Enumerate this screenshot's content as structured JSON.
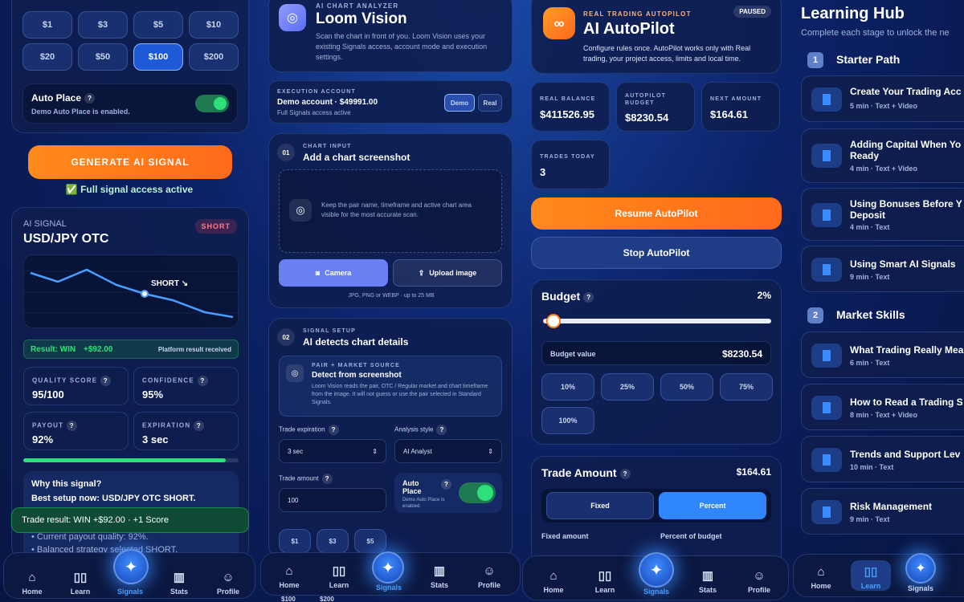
{
  "signals": {
    "amounts": [
      "$1",
      "$3",
      "$5",
      "$10",
      "$20",
      "$50",
      "$100",
      "$200"
    ],
    "selected_amount": "$100",
    "auto_place_title": "Auto Place",
    "auto_place_desc": "Demo Auto Place is enabled.",
    "generate_label": "GENERATE AI SIGNAL",
    "access_note": "✅ Full signal access active",
    "ai_label": "AI SIGNAL",
    "pair": "USD/JPY OTC",
    "direction": "SHORT",
    "chart_marker": "SHORT ↘",
    "result_text": "Result: WIN",
    "result_amount": "+$92.00",
    "result_note": "Platform result received",
    "metrics": [
      {
        "label": "QUALITY SCORE",
        "value": "95/100"
      },
      {
        "label": "CONFIDENCE",
        "value": "95%"
      },
      {
        "label": "PAYOUT",
        "value": "92%"
      },
      {
        "label": "EXPIRATION",
        "value": "3 sec"
      }
    ],
    "progress": 0.94,
    "why_title": "Why this signal?",
    "best_setup": "Best setup now: USD/JPY OTC SHORT.",
    "reasons": [
      "Current payout quality: 92%.",
      "Balanced strategy selected SHORT."
    ],
    "toast": "Trade result: WIN +$92.00 · +1 Score"
  },
  "vision": {
    "kicker": "AI CHART ANALYZER",
    "title": "Loom Vision",
    "desc": "Scan the chart in front of you. Loom Vision uses your existing Signals access, account mode and execution settings.",
    "exec_label": "EXECUTION ACCOUNT",
    "account": "Demo account · $49991.00",
    "access": "Full Signals access active",
    "demo": "Demo",
    "real": "Real",
    "step1_num": "01",
    "step1_kicker": "CHART INPUT",
    "step1_title": "Add a chart screenshot",
    "drop_hint": "Keep the pair name, timeframe and active chart area visible for the most accurate scan.",
    "camera": "Camera",
    "upload": "Upload image",
    "formats": "JPG, PNG or WEBP · up to 25 MB",
    "step2_num": "02",
    "step2_kicker": "SIGNAL SETUP",
    "step2_title": "AI detects chart details",
    "src_kicker": "PAIR + MARKET SOURCE",
    "src_title": "Detect from screenshot",
    "src_desc": "Loom Vision reads the pair, OTC / Regular market and chart timeframe from the image. It will not guess or use the pair selected in Standard Signals.",
    "exp_label": "Trade expiration",
    "exp_value": "3 sec",
    "style_label": "Analysis style",
    "style_value": "AI Analyst",
    "amount_label": "Trade amount",
    "amount_value": "100",
    "ap_title": "Auto Place",
    "ap_desc": "Demo Auto Place is enabled.",
    "quick": [
      "$1",
      "$3",
      "$5"
    ],
    "bottom": [
      "$100",
      "$200"
    ]
  },
  "autopilot": {
    "kicker": "REAL TRADING AUTOPILOT",
    "title": "AI AutoPilot",
    "status": "PAUSED",
    "desc": "Configure rules once. AutoPilot works only with Real trading, your project access, limits and local time.",
    "stats": [
      {
        "label": "REAL BALANCE",
        "value": "$411526.95"
      },
      {
        "label": "AUTOPILOT BUDGET",
        "value": "$8230.54"
      },
      {
        "label": "NEXT AMOUNT",
        "value": "$164.61"
      },
      {
        "label": "TRADES TODAY",
        "value": "3"
      }
    ],
    "resume": "Resume AutoPilot",
    "stop": "Stop AutoPilot",
    "budget_title": "Budget",
    "budget_pct": "2%",
    "budget_fraction": 0.02,
    "budget_value_label": "Budget value",
    "budget_value": "$8230.54",
    "pcts": [
      "10%",
      "25%",
      "50%",
      "75%",
      "100%"
    ],
    "trade_title": "Trade Amount",
    "trade_value": "$164.61",
    "fixed": "Fixed",
    "percent": "Percent",
    "fixed_amount": "Fixed amount",
    "pct_of_budget": "Percent of budget"
  },
  "hub": {
    "title": "Learning Hub",
    "subtitle": "Complete each stage to unlock the ne",
    "s1_num": "1",
    "s1": "Starter Path",
    "s2_num": "2",
    "s2": "Market Skills",
    "lessons1": [
      {
        "t": "Create Your Trading Acc",
        "s": "5 min · Text + Video"
      },
      {
        "t": "Adding Capital When Yo",
        "t2": "Ready",
        "s": "4 min · Text + Video"
      },
      {
        "t": "Using Bonuses Before Y",
        "t2": "Deposit",
        "s": "4 min · Text"
      },
      {
        "t": "Using Smart AI Signals",
        "s": "9 min · Text"
      }
    ],
    "lessons2": [
      {
        "t": "What Trading Really Mea",
        "s": "6 min · Text"
      },
      {
        "t": "How to Read a Trading S",
        "s": "8 min · Text + Video"
      },
      {
        "t": "Trends and Support Lev",
        "s": "10 min · Text"
      },
      {
        "t": "Risk Management",
        "s": "9 min · Text"
      }
    ]
  },
  "nav": {
    "home": "Home",
    "learn": "Learn",
    "signals": "Signals",
    "stats": "Stats",
    "profile": "Profile"
  },
  "colors": {
    "orange": "#ff7a1a",
    "green": "#2ee07a",
    "accent": "#3a8cff"
  }
}
